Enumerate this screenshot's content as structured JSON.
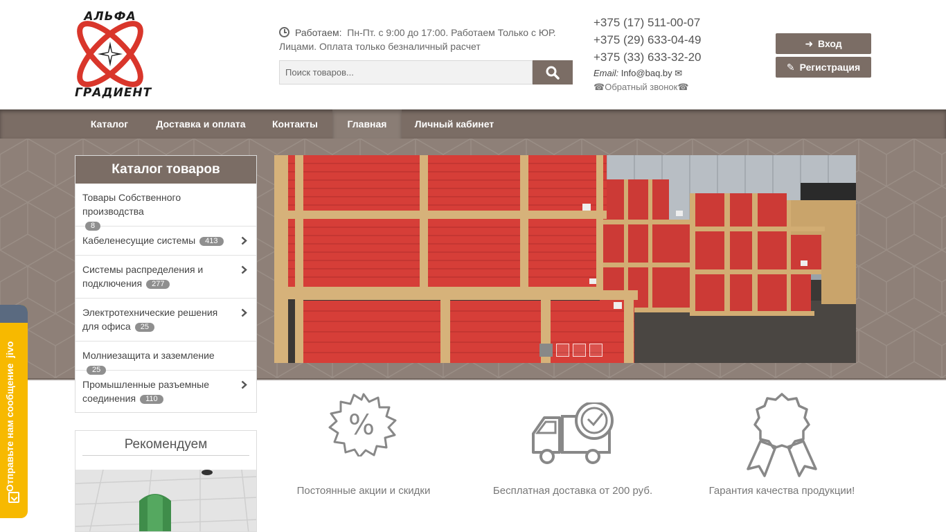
{
  "header": {
    "logo_top": "АЛЬФА",
    "logo_bottom": "ГРАДИЕНТ",
    "work_label": "Работаем:",
    "work_text": "Пн-Пт. с 9:00 до 17:00. Работаем Только с ЮР. Лицами. Оплата только безналичный расчет",
    "search_placeholder": "Поиск товаров...",
    "phones": [
      "+375 (17) 511-00-07",
      "+375 (29) 633-04-49",
      "+375 (33) 633-32-20"
    ],
    "email_label": "Email:",
    "email": "Info@baq.by",
    "callback": "Обратный звонок",
    "login": "Вход",
    "register": "Регистрация"
  },
  "nav": [
    {
      "label": "Каталог",
      "active": false
    },
    {
      "label": "Доставка и оплата",
      "active": false
    },
    {
      "label": "Контакты",
      "active": false
    },
    {
      "label": "Главная",
      "active": true
    },
    {
      "label": "Личный кабинет",
      "active": false
    }
  ],
  "catalog": {
    "title": "Каталог товаров",
    "items": [
      {
        "label": "Товары Собственного производства",
        "count": "8",
        "has_children": false
      },
      {
        "label": "Кабеленесущие системы",
        "count": "413",
        "has_children": true
      },
      {
        "label": "Системы распределения и подключения",
        "count": "277",
        "has_children": true
      },
      {
        "label": "Электротехнические решения для офиса",
        "count": "25",
        "has_children": true
      },
      {
        "label": "Молниезащита и заземление",
        "count": "25",
        "has_children": false
      },
      {
        "label": "Промышленные разъемные соединения",
        "count": "110",
        "has_children": true
      }
    ]
  },
  "slider": {
    "slide_count": 4,
    "active_index": 0
  },
  "recommend": {
    "title": "Рекомендуем"
  },
  "features": [
    {
      "label": "Постоянные акции и скидки",
      "icon": "discount-badge-icon"
    },
    {
      "label": "Бесплатная доставка от 200 руб.",
      "icon": "delivery-truck-icon"
    },
    {
      "label": "Гарантия качества продукции!",
      "icon": "quality-ribbon-icon"
    }
  ],
  "jivo": {
    "label": "Отправьте нам сообщение",
    "brand": "jivo"
  },
  "colors": {
    "brand_brown": "#7b6d65",
    "logo_red": "#d9362b",
    "jivo_yellow": "#f7b900"
  }
}
